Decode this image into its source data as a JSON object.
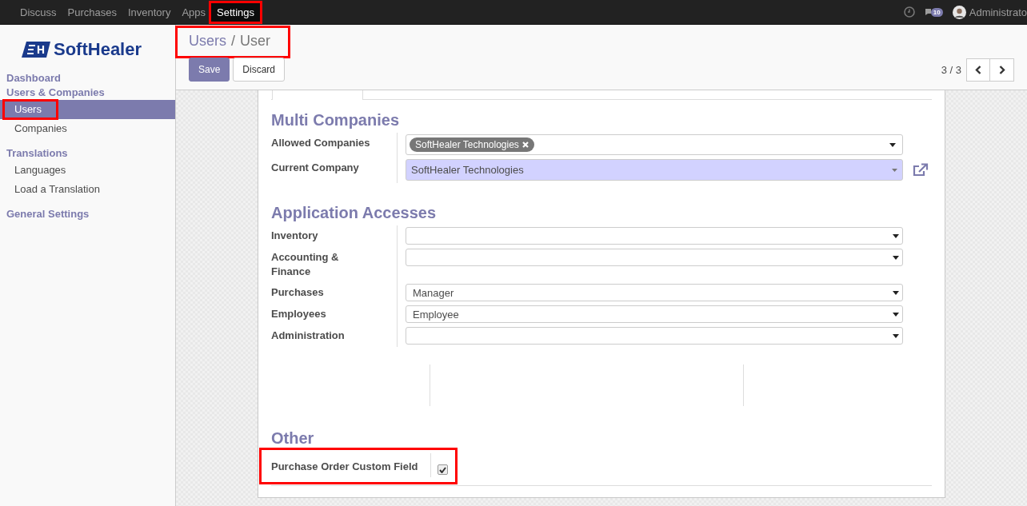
{
  "top_menu": [
    {
      "label": "Discuss",
      "selected": false,
      "highlighted": false
    },
    {
      "label": "Purchases",
      "selected": false,
      "highlighted": false
    },
    {
      "label": "Inventory",
      "selected": false,
      "highlighted": false
    },
    {
      "label": "Apps",
      "selected": false,
      "highlighted": false
    },
    {
      "label": "Settings",
      "selected": true,
      "highlighted": true
    }
  ],
  "systray": {
    "message_count": "10",
    "user": "Administrato"
  },
  "brand": {
    "name": "SoftHealer"
  },
  "sidebar": [
    {
      "label": "Dashboard",
      "kind": "header"
    },
    {
      "label": "Users & Companies",
      "kind": "header"
    },
    {
      "label": "Users",
      "kind": "item",
      "selected": true,
      "highlighted": true
    },
    {
      "label": "Companies",
      "kind": "item",
      "selected": false,
      "highlighted": false
    },
    {
      "label": "Translations",
      "kind": "header"
    },
    {
      "label": "Languages",
      "kind": "item",
      "selected": false,
      "highlighted": false
    },
    {
      "label": "Load a Translation",
      "kind": "item",
      "selected": false,
      "highlighted": false
    },
    {
      "label": "General Settings",
      "kind": "header"
    }
  ],
  "breadcrumb": {
    "items": [
      "Users",
      "User"
    ],
    "separator": "/",
    "highlighted": true
  },
  "buttons": [
    {
      "label": "Save",
      "kind": "primary"
    },
    {
      "label": "Discard",
      "kind": "secondary"
    }
  ],
  "pager": {
    "value": "3 / 3"
  },
  "sections": [
    {
      "title": "Multi Companies",
      "fields": [
        {
          "label": "Allowed Companies",
          "kind": "tags",
          "tags": [
            "SoftHealer Technologies"
          ]
        },
        {
          "label": "Current Company",
          "kind": "many2one",
          "value": "SoftHealer Technologies"
        }
      ]
    },
    {
      "title": "Application Accesses",
      "fields": [
        {
          "label": "Inventory",
          "kind": "select"
        },
        {
          "label": "Accounting & Finance",
          "kind": "select"
        },
        {
          "label": "Purchases",
          "kind": "select",
          "value": "Manager"
        },
        {
          "label": "Employees",
          "kind": "select",
          "value": "Employee"
        },
        {
          "label": "Administration",
          "kind": "select"
        }
      ]
    },
    {
      "title": "Other",
      "fields": [
        {
          "label": "Purchase Order Custom Field",
          "kind": "checkbox",
          "checked": true,
          "highlighted": true
        }
      ]
    }
  ]
}
